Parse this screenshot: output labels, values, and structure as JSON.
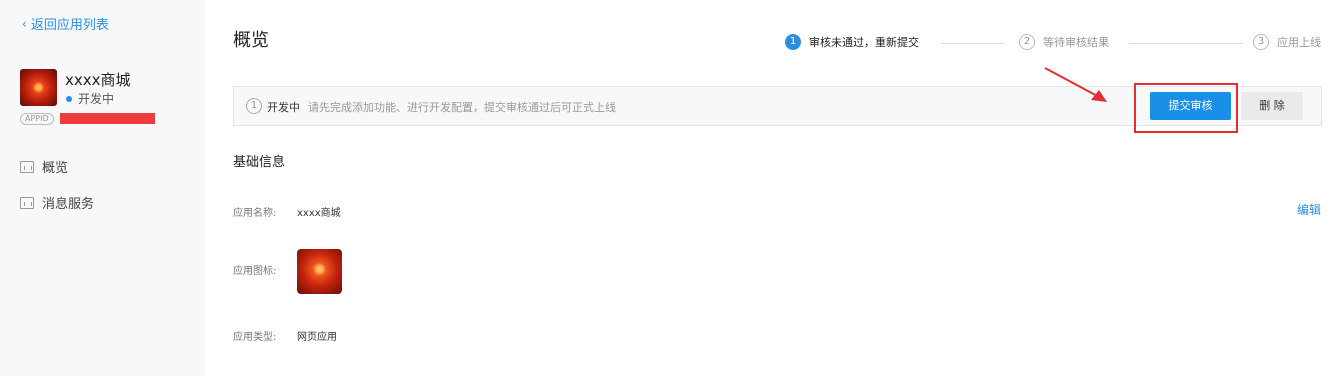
{
  "sidebar": {
    "back_label": "返回应用列表",
    "app_name": "xxxx商城",
    "app_status": "开发中",
    "appid_badge": "APPID",
    "nav": [
      {
        "label": "概览",
        "icon": "chart-icon"
      },
      {
        "label": "消息服务",
        "icon": "message-icon"
      }
    ]
  },
  "main": {
    "title": "概览",
    "steps": [
      {
        "num": "1",
        "label": "审核未通过，重新提交",
        "active": true
      },
      {
        "num": "2",
        "label": "等待审核结果",
        "active": false
      },
      {
        "num": "3",
        "label": "应用上线",
        "active": false
      }
    ],
    "banner": {
      "info_icon": "1",
      "state": "开发中",
      "hint": "请先完成添加功能、进行开发配置，提交审核通过后可正式上线"
    },
    "buttons": {
      "submit": "提交审核",
      "delete": "删 除"
    },
    "section_title": "基础信息",
    "edit_label": "编辑",
    "fields": {
      "name_label": "应用名称:",
      "name_value": "xxxx商城",
      "icon_label": "应用图标:",
      "type_label": "应用类型:",
      "type_value": "网页应用"
    }
  },
  "colors": {
    "accent": "#2a8fe0",
    "primary_button": "#1a8fe8",
    "annotation_red": "#e52e2e"
  }
}
